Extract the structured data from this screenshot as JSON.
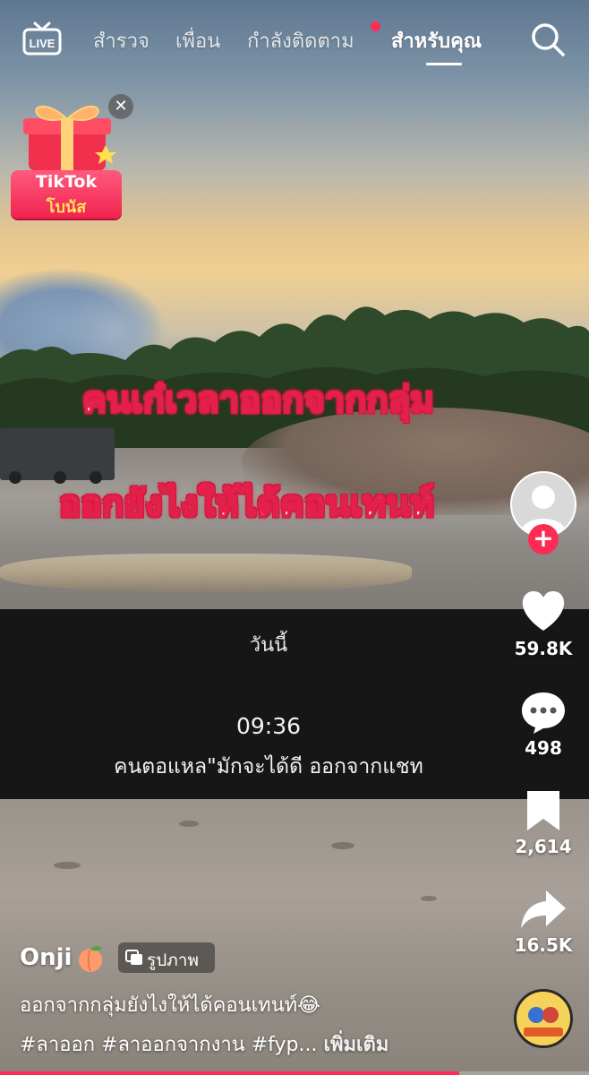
{
  "topnav": {
    "live_label": "LIVE",
    "tabs": [
      {
        "label": "สำรวจ",
        "active": false
      },
      {
        "label": "เพื่อน",
        "active": false
      },
      {
        "label": "กำลังติดตาม",
        "active": false,
        "notification_dot": true
      },
      {
        "label": "สำหรับคุณ",
        "active": true
      }
    ],
    "search_icon": "search-icon"
  },
  "bonus_widget": {
    "line1": "TikTok",
    "line2": "โบนัส",
    "close_icon": "close-icon"
  },
  "video_overlay": {
    "line1": "คนเก๋เวลาออกจากกลุ่ม",
    "line2": "ออกยังไงให้ได้คอนเทนท์"
  },
  "chat_panel": {
    "date_label": "วันนี้",
    "time": "09:36",
    "message": "คนตอแหล\"มักจะได้ดี ออกจากแชท"
  },
  "actions": {
    "likes": "59.8K",
    "comments": "498",
    "saves": "2,614",
    "shares": "16.5K"
  },
  "post": {
    "username": "Onji",
    "username_emoji": "peach",
    "content_type_label": "รูปภาพ",
    "description": "ออกจากกลุ่มยังไงให้ได้คอนเทนท์😂",
    "hashtags": "#ลาออก #ลาออกจากงาน #fyp...",
    "see_more": "เพิ่มเติม"
  },
  "colors": {
    "accent": "#fe2c55",
    "overlay_text_stroke": "#e3204a",
    "chat_panel_bg": "#161616"
  },
  "progress": {
    "fraction": 0.78
  }
}
